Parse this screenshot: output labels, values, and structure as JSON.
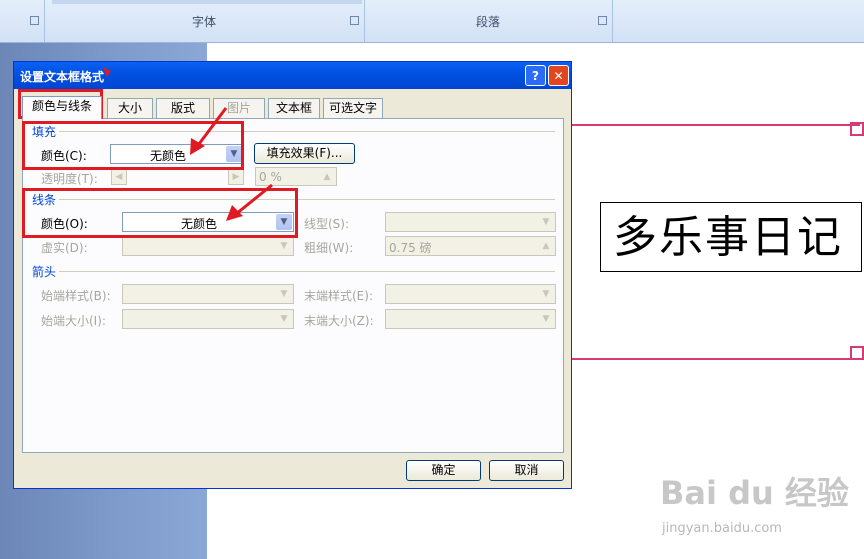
{
  "ribbon": {
    "group_font": "字体",
    "group_paragraph": "段落"
  },
  "document": {
    "title_text": "多乐事日记",
    "watermark": "Bai du 经验",
    "watermark_url": "jingyan.baidu.com"
  },
  "dialog": {
    "title": "设置文本框格式",
    "help": "?",
    "close": "✕",
    "tabs": [
      {
        "label": "颜色与线条",
        "active": true
      },
      {
        "label": "大小"
      },
      {
        "label": "版式"
      },
      {
        "label": "图片",
        "disabled": true
      },
      {
        "label": "文本框"
      },
      {
        "label": "可选文字"
      }
    ],
    "fill": {
      "section": "填充",
      "color_label": "颜色(C):",
      "color_value": "无颜色",
      "effects_button": "填充效果(F)...",
      "transparency_label": "透明度(T):",
      "transparency_value": "0 %"
    },
    "line": {
      "section": "线条",
      "color_label": "颜色(O):",
      "color_value": "无颜色",
      "style_label": "线型(S):",
      "dash_label": "虚实(D):",
      "weight_label": "粗细(W):",
      "weight_value": "0.75 磅"
    },
    "arrows": {
      "section": "箭头",
      "begin_style": "始端样式(B):",
      "end_style": "末端样式(E):",
      "begin_size": "始端大小(I):",
      "end_size": "末端大小(Z):"
    },
    "ok": "确定",
    "cancel": "取消"
  },
  "colors": {
    "annotation_red": "#e01a22",
    "title_blue": "#0251e4",
    "section_blue": "#0046d5"
  }
}
